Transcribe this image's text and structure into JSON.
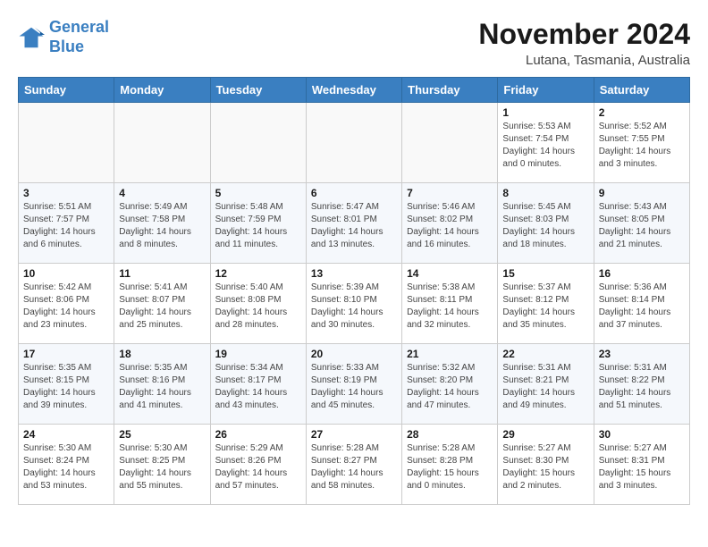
{
  "logo": {
    "line1": "General",
    "line2": "Blue"
  },
  "title": "November 2024",
  "subtitle": "Lutana, Tasmania, Australia",
  "weekdays": [
    "Sunday",
    "Monday",
    "Tuesday",
    "Wednesday",
    "Thursday",
    "Friday",
    "Saturday"
  ],
  "weeks": [
    [
      {
        "day": "",
        "info": ""
      },
      {
        "day": "",
        "info": ""
      },
      {
        "day": "",
        "info": ""
      },
      {
        "day": "",
        "info": ""
      },
      {
        "day": "",
        "info": ""
      },
      {
        "day": "1",
        "info": "Sunrise: 5:53 AM\nSunset: 7:54 PM\nDaylight: 14 hours and 0 minutes."
      },
      {
        "day": "2",
        "info": "Sunrise: 5:52 AM\nSunset: 7:55 PM\nDaylight: 14 hours and 3 minutes."
      }
    ],
    [
      {
        "day": "3",
        "info": "Sunrise: 5:51 AM\nSunset: 7:57 PM\nDaylight: 14 hours and 6 minutes."
      },
      {
        "day": "4",
        "info": "Sunrise: 5:49 AM\nSunset: 7:58 PM\nDaylight: 14 hours and 8 minutes."
      },
      {
        "day": "5",
        "info": "Sunrise: 5:48 AM\nSunset: 7:59 PM\nDaylight: 14 hours and 11 minutes."
      },
      {
        "day": "6",
        "info": "Sunrise: 5:47 AM\nSunset: 8:01 PM\nDaylight: 14 hours and 13 minutes."
      },
      {
        "day": "7",
        "info": "Sunrise: 5:46 AM\nSunset: 8:02 PM\nDaylight: 14 hours and 16 minutes."
      },
      {
        "day": "8",
        "info": "Sunrise: 5:45 AM\nSunset: 8:03 PM\nDaylight: 14 hours and 18 minutes."
      },
      {
        "day": "9",
        "info": "Sunrise: 5:43 AM\nSunset: 8:05 PM\nDaylight: 14 hours and 21 minutes."
      }
    ],
    [
      {
        "day": "10",
        "info": "Sunrise: 5:42 AM\nSunset: 8:06 PM\nDaylight: 14 hours and 23 minutes."
      },
      {
        "day": "11",
        "info": "Sunrise: 5:41 AM\nSunset: 8:07 PM\nDaylight: 14 hours and 25 minutes."
      },
      {
        "day": "12",
        "info": "Sunrise: 5:40 AM\nSunset: 8:08 PM\nDaylight: 14 hours and 28 minutes."
      },
      {
        "day": "13",
        "info": "Sunrise: 5:39 AM\nSunset: 8:10 PM\nDaylight: 14 hours and 30 minutes."
      },
      {
        "day": "14",
        "info": "Sunrise: 5:38 AM\nSunset: 8:11 PM\nDaylight: 14 hours and 32 minutes."
      },
      {
        "day": "15",
        "info": "Sunrise: 5:37 AM\nSunset: 8:12 PM\nDaylight: 14 hours and 35 minutes."
      },
      {
        "day": "16",
        "info": "Sunrise: 5:36 AM\nSunset: 8:14 PM\nDaylight: 14 hours and 37 minutes."
      }
    ],
    [
      {
        "day": "17",
        "info": "Sunrise: 5:35 AM\nSunset: 8:15 PM\nDaylight: 14 hours and 39 minutes."
      },
      {
        "day": "18",
        "info": "Sunrise: 5:35 AM\nSunset: 8:16 PM\nDaylight: 14 hours and 41 minutes."
      },
      {
        "day": "19",
        "info": "Sunrise: 5:34 AM\nSunset: 8:17 PM\nDaylight: 14 hours and 43 minutes."
      },
      {
        "day": "20",
        "info": "Sunrise: 5:33 AM\nSunset: 8:19 PM\nDaylight: 14 hours and 45 minutes."
      },
      {
        "day": "21",
        "info": "Sunrise: 5:32 AM\nSunset: 8:20 PM\nDaylight: 14 hours and 47 minutes."
      },
      {
        "day": "22",
        "info": "Sunrise: 5:31 AM\nSunset: 8:21 PM\nDaylight: 14 hours and 49 minutes."
      },
      {
        "day": "23",
        "info": "Sunrise: 5:31 AM\nSunset: 8:22 PM\nDaylight: 14 hours and 51 minutes."
      }
    ],
    [
      {
        "day": "24",
        "info": "Sunrise: 5:30 AM\nSunset: 8:24 PM\nDaylight: 14 hours and 53 minutes."
      },
      {
        "day": "25",
        "info": "Sunrise: 5:30 AM\nSunset: 8:25 PM\nDaylight: 14 hours and 55 minutes."
      },
      {
        "day": "26",
        "info": "Sunrise: 5:29 AM\nSunset: 8:26 PM\nDaylight: 14 hours and 57 minutes."
      },
      {
        "day": "27",
        "info": "Sunrise: 5:28 AM\nSunset: 8:27 PM\nDaylight: 14 hours and 58 minutes."
      },
      {
        "day": "28",
        "info": "Sunrise: 5:28 AM\nSunset: 8:28 PM\nDaylight: 15 hours and 0 minutes."
      },
      {
        "day": "29",
        "info": "Sunrise: 5:27 AM\nSunset: 8:30 PM\nDaylight: 15 hours and 2 minutes."
      },
      {
        "day": "30",
        "info": "Sunrise: 5:27 AM\nSunset: 8:31 PM\nDaylight: 15 hours and 3 minutes."
      }
    ]
  ]
}
